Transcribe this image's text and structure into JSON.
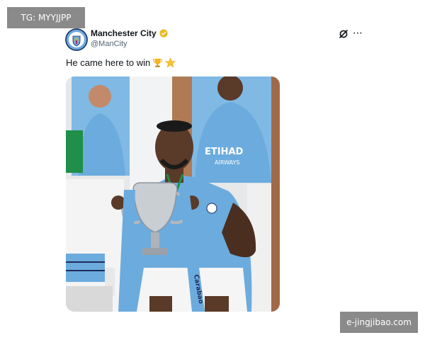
{
  "watermarks": {
    "top_left": "TG: MYYJJPP",
    "bottom_right": "e-jingjibao.com"
  },
  "tweet": {
    "author": {
      "display_name": "Manchester City",
      "handle": "@ManCity",
      "verified": true,
      "avatar_icon": "man-city-crest-icon"
    },
    "text": "He came here to win",
    "emojis": [
      "trophy-emoji",
      "star-emoji"
    ],
    "actions": [
      "grok-icon",
      "more-icon"
    ],
    "media": {
      "kind": "photo",
      "signage_text": [
        "Carabao",
        "ETIHAD",
        "AIRWAYS"
      ]
    }
  },
  "colors": {
    "city_blue": "#6cabdd",
    "verified_gold": "#e8b923",
    "text_primary": "#0f1419",
    "text_secondary": "#536471",
    "watermark_bg": "#8a8a8a"
  }
}
